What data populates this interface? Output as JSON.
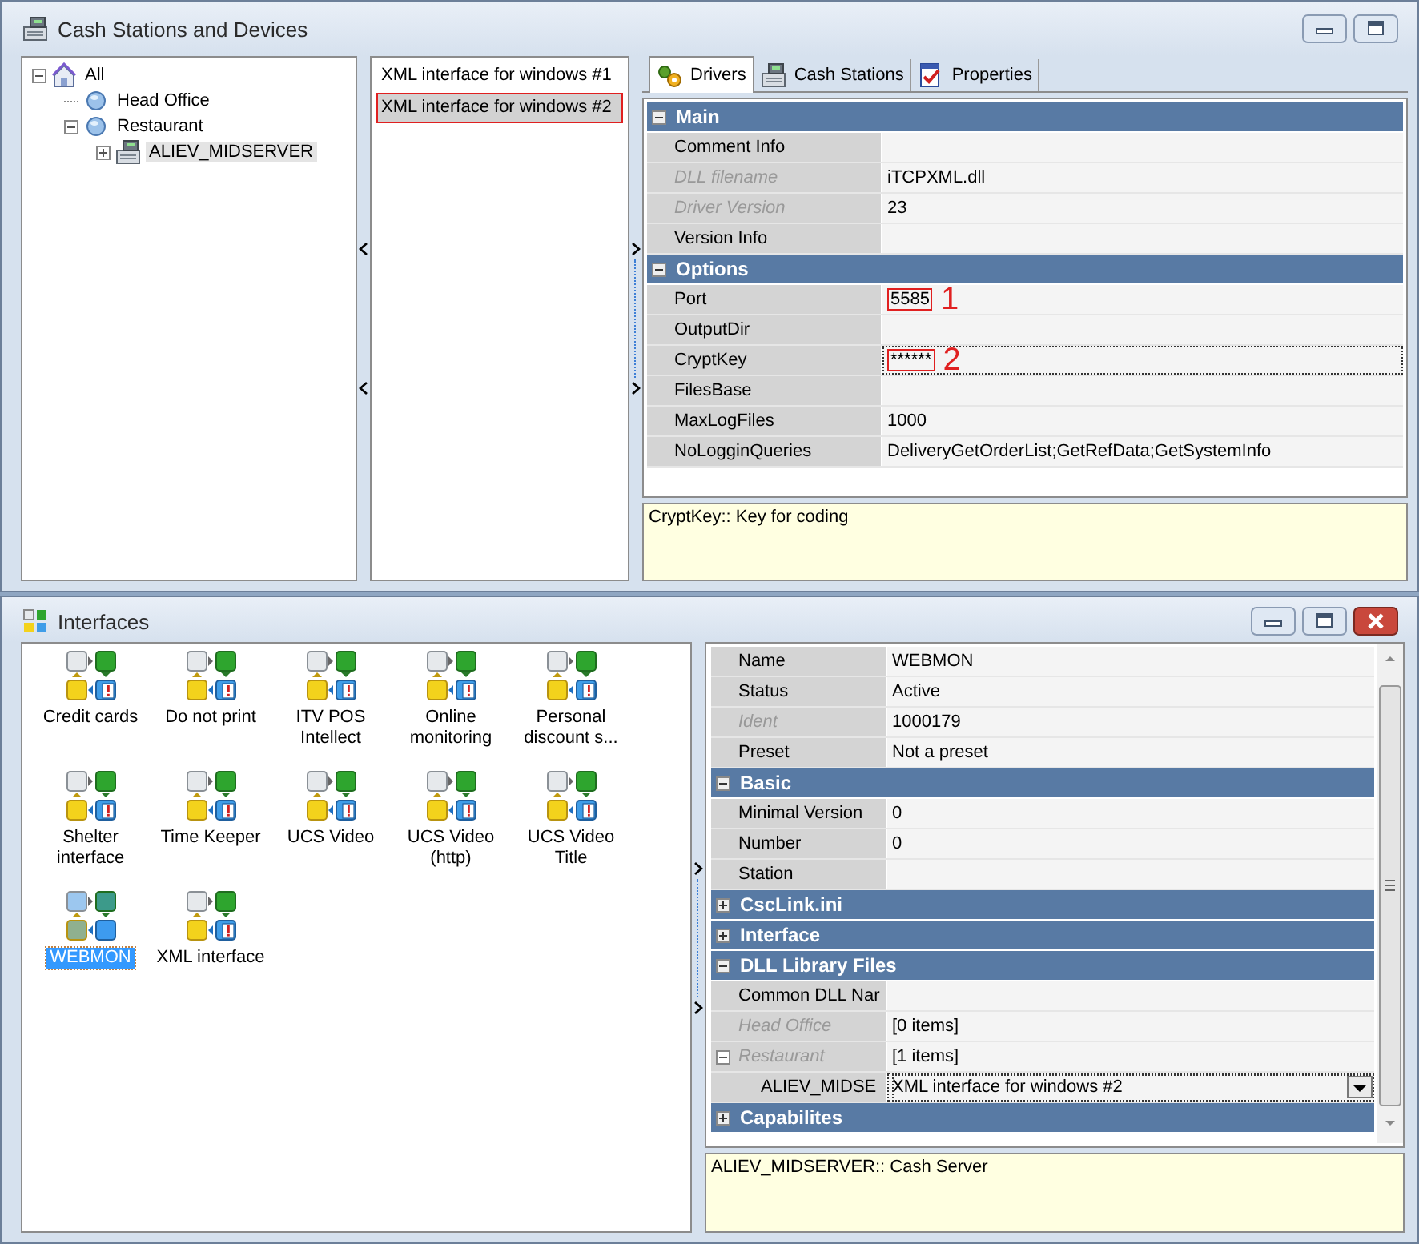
{
  "cash_window": {
    "title": "Cash Stations and Devices",
    "tree": [
      {
        "label": "All",
        "kind": "root",
        "expanded": true,
        "selected": false,
        "children": [
          {
            "label": "Head Office",
            "kind": "group",
            "selected": false
          },
          {
            "label": "Restaurant",
            "kind": "group",
            "expanded": true,
            "selected": false,
            "children": [
              {
                "label": "ALIEV_MIDSERVER",
                "kind": "cash-station",
                "expanded": false,
                "selected": true
              }
            ]
          }
        ]
      }
    ],
    "tabs": [
      {
        "label": "Drivers",
        "kind": "drivers",
        "selected": true
      },
      {
        "label": "Cash Stations",
        "kind": "stations",
        "selected": false
      },
      {
        "label": "Properties",
        "kind": "properties",
        "selected": false
      }
    ],
    "drivers": [
      {
        "label": "XML interface for windows #1",
        "selected": false,
        "highlighted": false
      },
      {
        "label": "XML interface for windows #2",
        "selected": true,
        "highlighted": true
      }
    ],
    "properties": {
      "sections": [
        {
          "title": "Main",
          "expanded": true,
          "rows": [
            {
              "name": "Comment Info",
              "value": "",
              "readonly": false
            },
            {
              "name": "DLL filename",
              "value": "iTCPXML.dll",
              "readonly": true
            },
            {
              "name": "Driver Version",
              "value": "23",
              "readonly": true
            },
            {
              "name": "Version Info",
              "value": "",
              "readonly": false
            }
          ]
        },
        {
          "title": "Options",
          "expanded": true,
          "rows": [
            {
              "name": "Port",
              "value": "5585",
              "readonly": false,
              "highlighted": true,
              "annotation": "1"
            },
            {
              "name": "OutputDir",
              "value": "",
              "readonly": false
            },
            {
              "name": "CryptKey",
              "value": "******",
              "readonly": false,
              "focused": true,
              "highlighted": true,
              "annotation": "2"
            },
            {
              "name": "FilesBase",
              "value": "",
              "readonly": false
            },
            {
              "name": "MaxLogFiles",
              "value": "1000",
              "readonly": false
            },
            {
              "name": "NoLogginQueries",
              "value": "DeliveryGetOrderList;GetRefData;GetSystemInfo",
              "readonly": false
            }
          ]
        }
      ]
    },
    "description": "CryptKey:: Key for coding"
  },
  "interfaces_window": {
    "title": "Interfaces",
    "interfaces": [
      {
        "label": "Credit cards",
        "selected": false
      },
      {
        "label": "Do not print",
        "selected": false
      },
      {
        "label": "ITV POS Intellect",
        "selected": false
      },
      {
        "label": "Online monitoring",
        "selected": false
      },
      {
        "label": "Personal discount s...",
        "selected": false
      },
      {
        "label": "Shelter interface",
        "selected": false
      },
      {
        "label": "Time Keeper",
        "selected": false
      },
      {
        "label": "UCS Video",
        "selected": false
      },
      {
        "label": "UCS Video (http)",
        "selected": false
      },
      {
        "label": "UCS Video Title",
        "selected": false
      },
      {
        "label": "WEBMON",
        "selected": true
      },
      {
        "label": "XML interface",
        "selected": false
      }
    ],
    "properties": {
      "rows": [
        {
          "name": "Name",
          "value": "WEBMON",
          "readonly": false
        },
        {
          "name": "Status",
          "value": "Active",
          "readonly": false
        },
        {
          "name": "Ident",
          "value": "1000179",
          "readonly": true
        },
        {
          "name": "Preset",
          "value": "Not a preset",
          "readonly": false
        }
      ],
      "sections": [
        {
          "title": "Basic",
          "expanded": true,
          "rows": [
            {
              "name": "Minimal Version",
              "value": "0",
              "readonly": false
            },
            {
              "name": "Number",
              "value": "0",
              "readonly": false
            },
            {
              "name": "Station",
              "value": "",
              "readonly": false
            }
          ]
        },
        {
          "title": "CscLink.ini",
          "expanded": false
        },
        {
          "title": "Interface",
          "expanded": false
        },
        {
          "title": "DLL Library Files",
          "expanded": true,
          "rows": [
            {
              "name": "Common DLL Nar",
              "value": "",
              "readonly": false
            },
            {
              "name": "Head Office",
              "value": "[0 items]",
              "readonly": true
            },
            {
              "name": "Restaurant",
              "value": "[1 items]",
              "readonly": true,
              "kind": "group",
              "expanded": true,
              "children": [
                {
                  "name": "ALIEV_MIDSE",
                  "value": "XML interface for windows #2",
                  "readonly": false,
                  "kind": "dropdown",
                  "focused": true
                }
              ]
            }
          ]
        },
        {
          "title": "Capabilites",
          "expanded": false
        }
      ]
    },
    "description": "ALIEV_MIDSERVER:: Cash Server"
  }
}
